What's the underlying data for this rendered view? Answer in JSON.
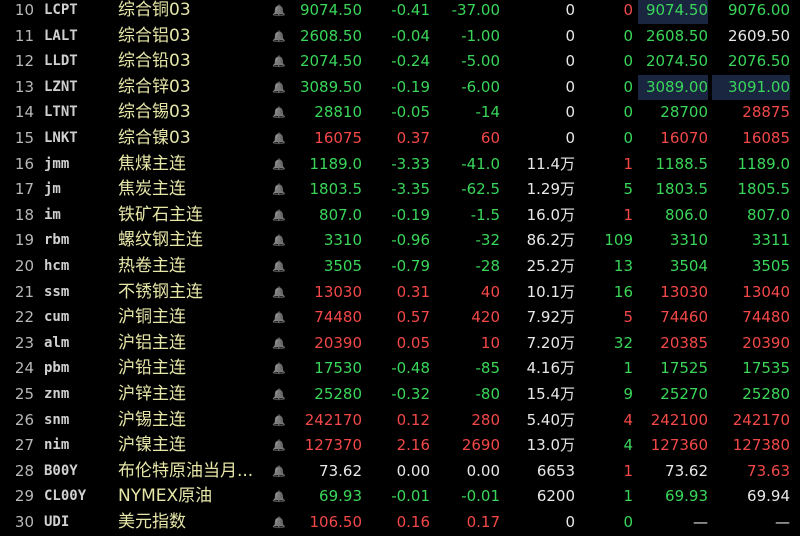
{
  "rows": [
    {
      "idx": "10",
      "code": "LCPT",
      "name": "综合铜03",
      "price": "9074.50",
      "chg": "-0.41",
      "pct": "-37.00",
      "vol": "0",
      "lot": "0",
      "bid": "9074.50",
      "ask": "9076.00",
      "trend": "down",
      "lotTrend": "up",
      "bidHl": true,
      "askHl": false
    },
    {
      "idx": "11",
      "code": "LALT",
      "name": "综合铝03",
      "price": "2608.50",
      "chg": "-0.04",
      "pct": "-1.00",
      "vol": "0",
      "lot": "0",
      "bid": "2608.50",
      "ask": "2609.50",
      "trend": "down",
      "lotTrend": "down",
      "bidHl": false,
      "askHl": false,
      "askColor": "flat"
    },
    {
      "idx": "12",
      "code": "LLDT",
      "name": "综合铅03",
      "price": "2074.50",
      "chg": "-0.24",
      "pct": "-5.00",
      "vol": "0",
      "lot": "0",
      "bid": "2074.50",
      "ask": "2076.50",
      "trend": "down",
      "lotTrend": "down",
      "bidHl": false,
      "askHl": false
    },
    {
      "idx": "13",
      "code": "LZNT",
      "name": "综合锌03",
      "price": "3089.50",
      "chg": "-0.19",
      "pct": "-6.00",
      "vol": "0",
      "lot": "0",
      "bid": "3089.00",
      "ask": "3091.00",
      "trend": "down",
      "lotTrend": "down",
      "bidHl": true,
      "askHl": true
    },
    {
      "idx": "14",
      "code": "LTNT",
      "name": "综合锡03",
      "price": "28810",
      "chg": "-0.05",
      "pct": "-14",
      "vol": "0",
      "lot": "0",
      "bid": "28700",
      "ask": "28875",
      "trend": "down",
      "lotTrend": "down",
      "bidHl": false,
      "askHl": false,
      "askColor": "up"
    },
    {
      "idx": "15",
      "code": "LNKT",
      "name": "综合镍03",
      "price": "16075",
      "chg": "0.37",
      "pct": "60",
      "vol": "0",
      "lot": "0",
      "bid": "16070",
      "ask": "16085",
      "trend": "up",
      "lotTrend": "down",
      "bidHl": false,
      "askHl": false
    },
    {
      "idx": "16",
      "code": "jmm",
      "name": "焦煤主连",
      "price": "1189.0",
      "chg": "-3.33",
      "pct": "-41.0",
      "vol": "11.4万",
      "lot": "1",
      "bid": "1188.5",
      "ask": "1189.0",
      "trend": "down",
      "lotTrend": "up"
    },
    {
      "idx": "17",
      "code": "jm",
      "name": "焦炭主连",
      "price": "1803.5",
      "chg": "-3.35",
      "pct": "-62.5",
      "vol": "1.29万",
      "lot": "5",
      "bid": "1803.5",
      "ask": "1805.5",
      "trend": "down",
      "lotTrend": "down"
    },
    {
      "idx": "18",
      "code": "im",
      "name": "铁矿石主连",
      "price": "807.0",
      "chg": "-0.19",
      "pct": "-1.5",
      "vol": "16.0万",
      "lot": "1",
      "bid": "806.0",
      "ask": "807.0",
      "trend": "down",
      "lotTrend": "up"
    },
    {
      "idx": "19",
      "code": "rbm",
      "name": "螺纹钢主连",
      "price": "3310",
      "chg": "-0.96",
      "pct": "-32",
      "vol": "86.2万",
      "lot": "109",
      "bid": "3310",
      "ask": "3311",
      "trend": "down",
      "lotTrend": "down"
    },
    {
      "idx": "20",
      "code": "hcm",
      "name": "热卷主连",
      "price": "3505",
      "chg": "-0.79",
      "pct": "-28",
      "vol": "25.2万",
      "lot": "13",
      "bid": "3504",
      "ask": "3505",
      "trend": "down",
      "lotTrend": "down"
    },
    {
      "idx": "21",
      "code": "ssm",
      "name": "不锈钢主连",
      "price": "13030",
      "chg": "0.31",
      "pct": "40",
      "vol": "10.1万",
      "lot": "16",
      "bid": "13030",
      "ask": "13040",
      "trend": "up",
      "lotTrend": "down"
    },
    {
      "idx": "22",
      "code": "cum",
      "name": "沪铜主连",
      "price": "74480",
      "chg": "0.57",
      "pct": "420",
      "vol": "7.92万",
      "lot": "5",
      "bid": "74460",
      "ask": "74480",
      "trend": "up",
      "lotTrend": "up"
    },
    {
      "idx": "23",
      "code": "alm",
      "name": "沪铝主连",
      "price": "20390",
      "chg": "0.05",
      "pct": "10",
      "vol": "7.20万",
      "lot": "32",
      "bid": "20385",
      "ask": "20390",
      "trend": "up",
      "lotTrend": "down"
    },
    {
      "idx": "24",
      "code": "pbm",
      "name": "沪铅主连",
      "price": "17530",
      "chg": "-0.48",
      "pct": "-85",
      "vol": "4.16万",
      "lot": "1",
      "bid": "17525",
      "ask": "17535",
      "trend": "down",
      "lotTrend": "down"
    },
    {
      "idx": "25",
      "code": "znm",
      "name": "沪锌主连",
      "price": "25280",
      "chg": "-0.32",
      "pct": "-80",
      "vol": "15.4万",
      "lot": "9",
      "bid": "25270",
      "ask": "25280",
      "trend": "down",
      "lotTrend": "down"
    },
    {
      "idx": "26",
      "code": "snm",
      "name": "沪锡主连",
      "price": "242170",
      "chg": "0.12",
      "pct": "280",
      "vol": "5.40万",
      "lot": "4",
      "bid": "242100",
      "ask": "242170",
      "trend": "up",
      "lotTrend": "up"
    },
    {
      "idx": "27",
      "code": "nim",
      "name": "沪镍主连",
      "price": "127370",
      "chg": "2.16",
      "pct": "2690",
      "vol": "13.0万",
      "lot": "4",
      "bid": "127360",
      "ask": "127380",
      "trend": "up",
      "lotTrend": "down"
    },
    {
      "idx": "28",
      "code": "B00Y",
      "name": "布伦特原油当月...",
      "price": "73.62",
      "chg": "0.00",
      "pct": "0.00",
      "vol": "6653",
      "lot": "1",
      "bid": "73.62",
      "ask": "73.63",
      "trend": "flat",
      "lotTrend": "up",
      "askColor": "up"
    },
    {
      "idx": "29",
      "code": "CL00Y",
      "name": "NYMEX原油",
      "price": "69.93",
      "chg": "-0.01",
      "pct": "-0.01",
      "vol": "6200",
      "lot": "1",
      "bid": "69.93",
      "ask": "69.94",
      "trend": "down",
      "lotTrend": "down",
      "askColor": "flat"
    },
    {
      "idx": "30",
      "code": "UDI",
      "name": "美元指数",
      "price": "106.50",
      "chg": "0.16",
      "pct": "0.17",
      "vol": "0",
      "lot": "0",
      "bid": "—",
      "ask": "—",
      "trend": "up",
      "lotTrend": "down",
      "bidColor": "flat",
      "askColor": "flat"
    }
  ],
  "colors": {
    "up": "#f34848",
    "down": "#3ad65a",
    "flat": "#e8e8e8",
    "highlight": "#1a2640"
  },
  "icons": {
    "alert": "bell-icon"
  }
}
